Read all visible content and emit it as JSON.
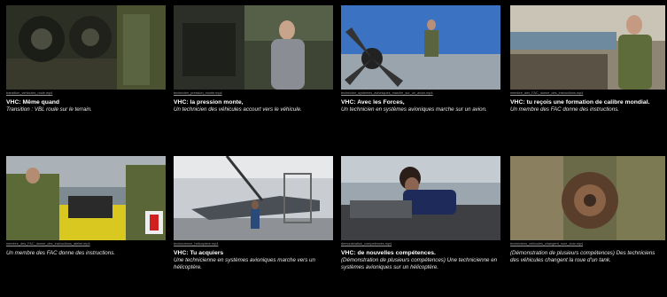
{
  "cards": [
    {
      "filename": "transition_vehicules_roule.mp4",
      "title": "VHC: Même quand",
      "desc": "Transition : VBL roule sur le terrain."
    },
    {
      "filename": "technicien_pression_monte.mp4",
      "title": "VHC: la pression monte,",
      "desc": "Un technicien des véhicules accourt vers le véhicule."
    },
    {
      "filename": "technicien_systemes_avioniques_marche_sur_un_avion.mp4",
      "title": "VHC: Avec les Forces,",
      "desc": "Un technicien en systèmes avioniques marche sur un avion."
    },
    {
      "filename": "membre_des_FAC_donne_des_instructions.mp4",
      "title": "VHC: tu reçois une formation de calibre mondial.",
      "desc": "Un membre des FAC donne des instructions."
    },
    {
      "filename": "membre_des_FAC_donne_des_instructions_atelier.mp4",
      "title": "",
      "desc": "Un membre des FAC donne des instructions."
    },
    {
      "filename": "technicienne_helicoptere.mp4",
      "title": "VHC: Tu acquiers",
      "desc": "Une technicienne en systèmes avioniques marche vers un hélicoptère."
    },
    {
      "filename": "demonstration_competences.mp4",
      "title": "VHC: de nouvelles compétences.",
      "desc": "(Démonstration de plusieurs compétences) Une technicienne en systèmes avioniques sur un hélicoptère."
    },
    {
      "filename": "techniciens_vehicules_changent_roue_char.mp4",
      "title": "",
      "desc": "(Démonstration de plusieurs compétences) Des techniciens des véhicules changent la roue d'un tank."
    }
  ]
}
